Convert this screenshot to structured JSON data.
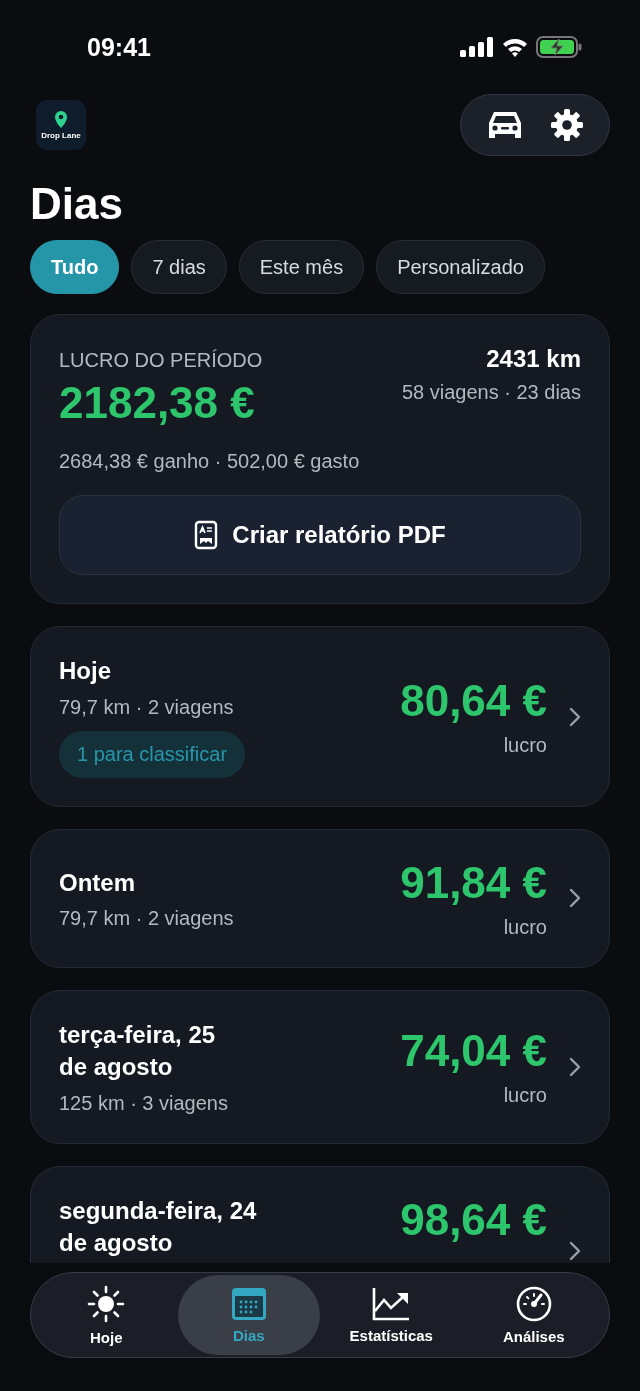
{
  "status_bar": {
    "time": "09:41"
  },
  "header": {
    "logo_text": "Drop Lane"
  },
  "title": "Dias",
  "filters": [
    {
      "label": "Tudo",
      "selected": true
    },
    {
      "label": "7 dias",
      "selected": false
    },
    {
      "label": "Este mês",
      "selected": false
    },
    {
      "label": "Personalizado",
      "selected": false
    }
  ],
  "summary": {
    "label": "LUCRO DO PERÍODO",
    "profit": "2182,38 €",
    "distance": "2431 km",
    "counts": "58 viagens · 23 dias",
    "breakdown": "2684,38 € ganho · 502,00 € gasto",
    "button": "Criar relatório PDF"
  },
  "days": [
    {
      "title": "Hoje",
      "meta": "79,7 km · 2 viagens",
      "badge": "1 para classificar",
      "amount": "80,64 €",
      "amount_label": "lucro"
    },
    {
      "title": "Ontem",
      "meta": "79,7 km · 2 viagens",
      "amount": "91,84 €",
      "amount_label": "lucro"
    },
    {
      "title": "terça-feira, 25\nde agosto",
      "meta": "125 km · 3 viagens",
      "amount": "74,04 €",
      "amount_label": "lucro"
    },
    {
      "title": "segunda-feira, 24\nde agosto",
      "amount": "98,64 €"
    }
  ],
  "tab_bar": [
    {
      "kind": "sun",
      "label": "Hoje",
      "selected": false
    },
    {
      "kind": "calendar",
      "label": "Dias",
      "selected": true
    },
    {
      "kind": "chart",
      "label": "Estatísticas",
      "selected": false
    },
    {
      "kind": "gauge",
      "label": "Análises",
      "selected": false
    }
  ]
}
